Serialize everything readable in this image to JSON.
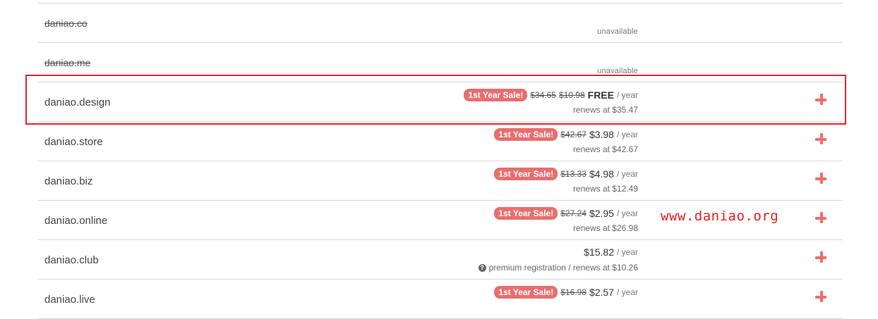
{
  "rows": [
    {
      "domain": "daniao.co",
      "status": "unavailable"
    },
    {
      "domain": "daniao.me",
      "status": "unavailable"
    },
    {
      "domain": "daniao.design",
      "badge": "1st Year Sale!",
      "old_price": "$34.65",
      "old_price_2": "$10.98",
      "price": "FREE",
      "per": "/ year",
      "renews": "renews at $35.47"
    },
    {
      "domain": "daniao.store",
      "badge": "1st Year Sale!",
      "old_price": "$42.67",
      "price": "$3.98",
      "per": "/ year",
      "renews": "renews at $42.67"
    },
    {
      "domain": "daniao.biz",
      "badge": "1st Year Sale!",
      "old_price": "$13.33",
      "price": "$4.98",
      "per": "/ year",
      "renews": "renews at $12.49"
    },
    {
      "domain": "daniao.online",
      "badge": "1st Year Sale!",
      "old_price": "$27.24",
      "price": "$2.95",
      "per": "/ year",
      "renews": "renews at $26.98"
    },
    {
      "domain": "daniao.club",
      "price": "$15.82",
      "per": "/ year",
      "renews": "premium registration / renews at $10.26",
      "help_icon": "question-circle-icon"
    },
    {
      "domain": "daniao.live",
      "badge": "1st Year Sale!",
      "old_price": "$16.98",
      "price": "$2.57",
      "per": "/ year"
    }
  ],
  "watermark": "www.daniao.org",
  "colors": {
    "badge": "#e96e6e",
    "add": "#ee6e6e",
    "highlight": "#e0282f",
    "watermark": "#e02020"
  }
}
